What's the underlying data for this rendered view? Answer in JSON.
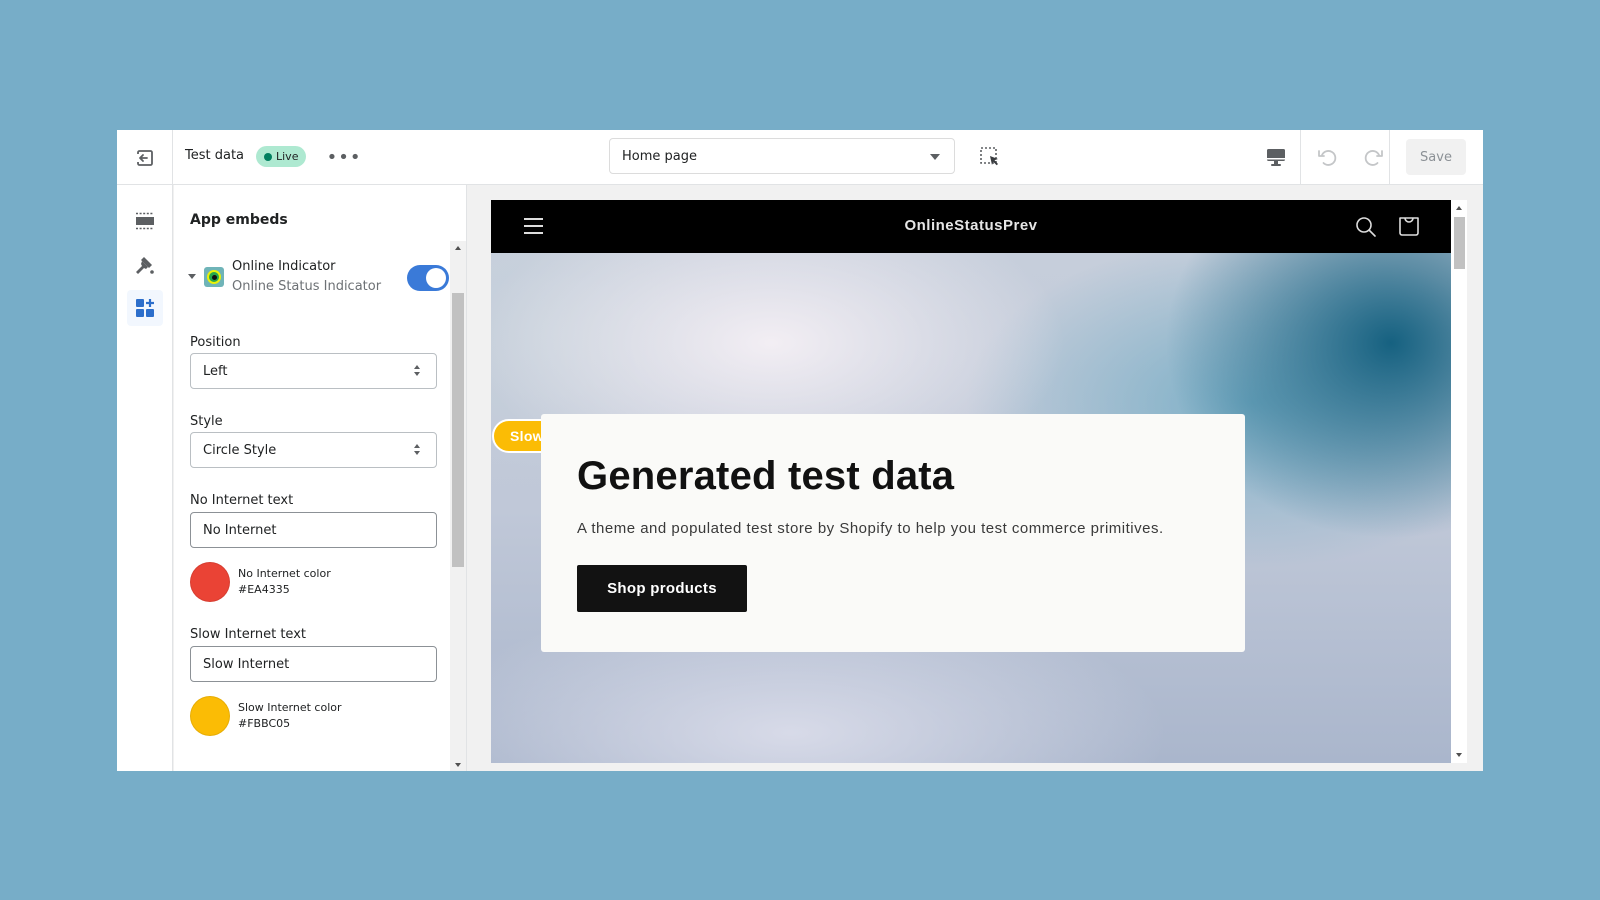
{
  "topbar": {
    "exit_icon": "exit-icon",
    "title": "Test data",
    "status_badge": "Live",
    "more_icon": "more-horizontal-icon",
    "more_label": "•••",
    "page_select": {
      "value": "Home page"
    },
    "inspector_icon": "select-inspect-icon",
    "viewport_icon": "desktop-icon",
    "undo_icon": "undo-icon",
    "redo_icon": "redo-icon",
    "save_label": "Save"
  },
  "rail": {
    "items": [
      {
        "name": "sections",
        "icon": "sections-icon",
        "active": false
      },
      {
        "name": "theme-settings",
        "icon": "paintbrush-icon",
        "active": false
      },
      {
        "name": "app-embeds",
        "icon": "apps-add-icon",
        "active": true
      }
    ]
  },
  "panel": {
    "title": "App embeds",
    "embed": {
      "name": "Online Indicator",
      "subtitle": "Online Status Indicator",
      "enabled": true
    },
    "fields": {
      "position": {
        "label": "Position",
        "value": "Left"
      },
      "style": {
        "label": "Style",
        "value": "Circle Style"
      },
      "no_internet_text": {
        "label": "No Internet text",
        "value": "No Internet"
      },
      "no_internet_color": {
        "label": "No Internet color",
        "value": "#EA4335"
      },
      "slow_internet_text": {
        "label": "Slow Internet text",
        "value": "Slow Internet"
      },
      "slow_internet_color": {
        "label": "Slow Internet color",
        "value": "#FBBC05"
      }
    }
  },
  "preview": {
    "store_name": "OnlineStatusPrev",
    "menu_icon": "hamburger-icon",
    "search_icon": "search-icon",
    "cart_icon": "cart-icon",
    "status_indicator": {
      "text": "Slow Internet",
      "color": "#FBBC05"
    },
    "hero": {
      "title": "Generated test data",
      "text": "A theme and populated test store by Shopify to help you test commerce primitives.",
      "button_label": "Shop products"
    }
  },
  "colors": {
    "background": "#77ADC8",
    "accent_blue": "#3A7AD8",
    "live_badge": "#AEE9D1",
    "no_internet": "#EA4335",
    "slow_internet": "#FBBC05"
  }
}
